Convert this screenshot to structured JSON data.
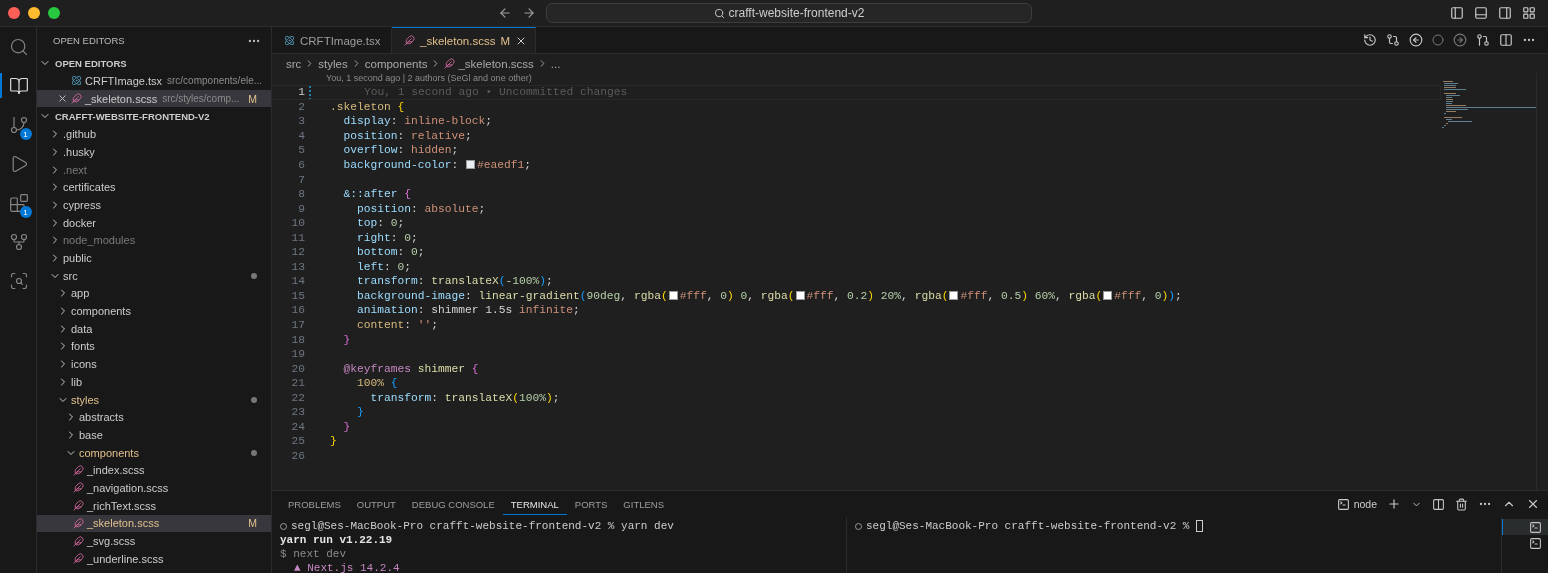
{
  "title_bar": {
    "search": "crafft-website-frontend-v2"
  },
  "activity_bar": [
    {
      "kind": "search",
      "selected": false
    },
    {
      "kind": "explorer",
      "selected": true
    },
    {
      "kind": "source-control",
      "selected": false,
      "badge": "1"
    },
    {
      "kind": "run",
      "selected": false
    },
    {
      "kind": "extensions",
      "selected": false,
      "badge": "1"
    },
    {
      "kind": "gitlens",
      "selected": false
    },
    {
      "kind": "inspect",
      "selected": false
    }
  ],
  "sidebar": {
    "title": "OPEN EDITORS",
    "open_editors": {
      "title": "OPEN EDITORS",
      "expanded": true,
      "items": [
        {
          "kind": "tsx",
          "name": "CRFTImage.tsx",
          "path": "src/components/ele...",
          "selected": false
        },
        {
          "kind": "scss",
          "name": "_skeleton.scss",
          "path": "src/styles/comp...",
          "badge": "M",
          "selected": true
        }
      ]
    },
    "explorer": {
      "title": "CRAFFT-WEBSITE-FRONTEND-V2",
      "expanded": true,
      "items": [
        {
          "name": ".github",
          "kind": "folder",
          "expanded": false,
          "dimmed": false,
          "modified": false,
          "dot": false,
          "selected": false
        },
        {
          "name": ".husky",
          "kind": "folder",
          "expanded": false,
          "dimmed": false,
          "modified": false,
          "dot": false,
          "selected": false
        },
        {
          "name": ".next",
          "kind": "folder",
          "expanded": false,
          "dimmed": true,
          "modified": false,
          "dot": false,
          "selected": false
        },
        {
          "name": "certificates",
          "kind": "folder",
          "expanded": false,
          "dimmed": false,
          "modified": false,
          "dot": false,
          "selected": false
        },
        {
          "name": "cypress",
          "kind": "folder",
          "expanded": false,
          "dimmed": false,
          "modified": false,
          "dot": false,
          "selected": false
        },
        {
          "name": "docker",
          "kind": "folder",
          "expanded": false,
          "dimmed": false,
          "modified": false,
          "dot": false,
          "selected": false
        },
        {
          "name": "node_modules",
          "kind": "folder",
          "expanded": false,
          "dimmed": true,
          "modified": false,
          "dot": false,
          "selected": false
        },
        {
          "name": "public",
          "kind": "folder",
          "expanded": false,
          "dimmed": false,
          "modified": false,
          "dot": false,
          "selected": false
        },
        {
          "name": "src",
          "kind": "folder",
          "expanded": true,
          "dimmed": false,
          "modified": false,
          "dot": true,
          "selected": false,
          "children": [
            {
              "name": "app",
              "kind": "folder",
              "expanded": false,
              "dimmed": false,
              "modified": false,
              "dot": false,
              "selected": false
            },
            {
              "name": "components",
              "kind": "folder",
              "expanded": false,
              "dimmed": false,
              "modified": false,
              "dot": false,
              "selected": false
            },
            {
              "name": "data",
              "kind": "folder",
              "expanded": false,
              "dimmed": false,
              "modified": false,
              "dot": false,
              "selected": false
            },
            {
              "name": "fonts",
              "kind": "folder",
              "expanded": false,
              "dimmed": false,
              "modified": false,
              "dot": false,
              "selected": false
            },
            {
              "name": "icons",
              "kind": "folder",
              "expanded": false,
              "dimmed": false,
              "modified": false,
              "dot": false,
              "selected": false
            },
            {
              "name": "lib",
              "kind": "folder",
              "expanded": false,
              "dimmed": false,
              "modified": false,
              "dot": false,
              "selected": false
            },
            {
              "name": "styles",
              "kind": "folder",
              "expanded": true,
              "dimmed": false,
              "modified": true,
              "dot": true,
              "selected": false,
              "children": [
                {
                  "name": "abstracts",
                  "kind": "folder",
                  "expanded": false,
                  "dimmed": false,
                  "modified": false,
                  "dot": false,
                  "selected": false
                },
                {
                  "name": "base",
                  "kind": "folder",
                  "expanded": false,
                  "dimmed": false,
                  "modified": false,
                  "dot": false,
                  "selected": false
                },
                {
                  "name": "components",
                  "kind": "folder",
                  "expanded": true,
                  "dimmed": false,
                  "modified": true,
                  "dot": true,
                  "selected": false,
                  "children": [
                    {
                      "name": "_index.scss",
                      "kind": "scss",
                      "dimmed": false,
                      "modified": false,
                      "dot": false,
                      "selected": false
                    },
                    {
                      "name": "_navigation.scss",
                      "kind": "scss",
                      "dimmed": false,
                      "modified": false,
                      "dot": false,
                      "selected": false
                    },
                    {
                      "name": "_richText.scss",
                      "kind": "scss",
                      "dimmed": false,
                      "modified": false,
                      "dot": false,
                      "selected": false
                    },
                    {
                      "name": "_skeleton.scss",
                      "kind": "scss",
                      "dimmed": false,
                      "modified": true,
                      "dot": false,
                      "selected": true,
                      "badge": "M"
                    },
                    {
                      "name": "_svg.scss",
                      "kind": "scss",
                      "dimmed": false,
                      "modified": false,
                      "dot": false,
                      "selected": false
                    },
                    {
                      "name": "_underline.scss",
                      "kind": "scss",
                      "dimmed": false,
                      "modified": false,
                      "dot": false,
                      "selected": false
                    }
                  ]
                }
              ]
            }
          ]
        }
      ]
    }
  },
  "editor": {
    "tabs": [
      {
        "label": "CRFTImage.tsx",
        "kind": "tsx",
        "selected": false
      },
      {
        "label": "_skeleton.scss",
        "kind": "scss",
        "selected": true,
        "badge": "M"
      }
    ],
    "breadcrumbs": [
      {
        "text": "src",
        "kind": "folder"
      },
      {
        "text": "styles",
        "kind": "folder"
      },
      {
        "text": "components",
        "kind": "folder"
      },
      {
        "text": "_skeleton.scss",
        "kind": "scss"
      },
      {
        "text": "...",
        "kind": "more"
      }
    ],
    "codelens": "You, 1 second ago | 2 authors (SeGl and one other)",
    "lines": [
      {
        "number": "1",
        "active": true,
        "tokens": [
          {
            "kind": "blame",
            "text": "You, 1 second ago • Uncommitted changes"
          }
        ]
      },
      {
        "number": "2",
        "active": false,
        "tokens": [
          {
            "kind": "selector",
            "text": ".skeleton "
          },
          {
            "kind": "brace1",
            "text": "{"
          }
        ]
      },
      {
        "number": "3",
        "active": false,
        "tokens": [
          {
            "kind": "prop",
            "text": "  display"
          },
          {
            "kind": "plain",
            "text": ": "
          },
          {
            "kind": "value",
            "text": "inline-block"
          },
          {
            "kind": "plain",
            "text": ";"
          }
        ]
      },
      {
        "number": "4",
        "active": false,
        "tokens": [
          {
            "kind": "prop",
            "text": "  position"
          },
          {
            "kind": "plain",
            "text": ": "
          },
          {
            "kind": "value",
            "text": "relative"
          },
          {
            "kind": "plain",
            "text": ";"
          }
        ]
      },
      {
        "number": "5",
        "active": false,
        "tokens": [
          {
            "kind": "prop",
            "text": "  overflow"
          },
          {
            "kind": "plain",
            "text": ": "
          },
          {
            "kind": "value",
            "text": "hidden"
          },
          {
            "kind": "plain",
            "text": ";"
          }
        ]
      },
      {
        "number": "6",
        "active": false,
        "tokens": [
          {
            "kind": "prop",
            "text": "  background-color"
          },
          {
            "kind": "plain",
            "text": ": "
          },
          {
            "kind": "swatch",
            "color": "#eaedf1"
          },
          {
            "kind": "value",
            "text": "#eaedf1"
          },
          {
            "kind": "plain",
            "text": ";"
          }
        ]
      },
      {
        "number": "7",
        "active": false
      },
      {
        "number": "8",
        "active": false,
        "tokens": [
          {
            "kind": "prop",
            "text": "  &::after "
          },
          {
            "kind": "brace2",
            "text": "{"
          }
        ]
      },
      {
        "number": "9",
        "active": false,
        "tokens": [
          {
            "kind": "prop",
            "text": "    position"
          },
          {
            "kind": "plain",
            "text": ": "
          },
          {
            "kind": "value",
            "text": "absolute"
          },
          {
            "kind": "plain",
            "text": ";"
          }
        ]
      },
      {
        "number": "10",
        "active": false,
        "tokens": [
          {
            "kind": "prop",
            "text": "    top"
          },
          {
            "kind": "plain",
            "text": ": "
          },
          {
            "kind": "number",
            "text": "0"
          },
          {
            "kind": "plain",
            "text": ";"
          }
        ]
      },
      {
        "number": "11",
        "active": false,
        "tokens": [
          {
            "kind": "prop",
            "text": "    right"
          },
          {
            "kind": "plain",
            "text": ": "
          },
          {
            "kind": "number",
            "text": "0"
          },
          {
            "kind": "plain",
            "text": ";"
          }
        ]
      },
      {
        "number": "12",
        "active": false,
        "tokens": [
          {
            "kind": "prop",
            "text": "    bottom"
          },
          {
            "kind": "plain",
            "text": ": "
          },
          {
            "kind": "number",
            "text": "0"
          },
          {
            "kind": "plain",
            "text": ";"
          }
        ]
      },
      {
        "number": "13",
        "active": false,
        "tokens": [
          {
            "kind": "prop",
            "text": "    left"
          },
          {
            "kind": "plain",
            "text": ": "
          },
          {
            "kind": "number",
            "text": "0"
          },
          {
            "kind": "plain",
            "text": ";"
          }
        ]
      },
      {
        "number": "14",
        "active": false,
        "tokens": [
          {
            "kind": "prop",
            "text": "    transform"
          },
          {
            "kind": "plain",
            "text": ": "
          },
          {
            "kind": "func",
            "text": "translateX"
          },
          {
            "kind": "brace3",
            "text": "("
          },
          {
            "kind": "number",
            "text": "-100%"
          },
          {
            "kind": "brace3",
            "text": ")"
          },
          {
            "kind": "plain",
            "text": ";"
          }
        ]
      },
      {
        "number": "15",
        "active": false,
        "tokens": [
          {
            "kind": "prop",
            "text": "    background-image"
          },
          {
            "kind": "plain",
            "text": ": "
          },
          {
            "kind": "func",
            "text": "linear-gradient"
          },
          {
            "kind": "brace3",
            "text": "("
          },
          {
            "kind": "number",
            "text": "90deg"
          },
          {
            "kind": "plain",
            "text": ", "
          },
          {
            "kind": "func",
            "text": "rgba"
          },
          {
            "kind": "brace1",
            "text": "("
          },
          {
            "kind": "swatch",
            "color": "#ffffff"
          },
          {
            "kind": "value",
            "text": "#fff"
          },
          {
            "kind": "plain",
            "text": ", "
          },
          {
            "kind": "number",
            "text": "0"
          },
          {
            "kind": "brace1",
            "text": ")"
          },
          {
            "kind": "number",
            "text": " 0"
          },
          {
            "kind": "plain",
            "text": ", "
          },
          {
            "kind": "func",
            "text": "rgba"
          },
          {
            "kind": "brace1",
            "text": "("
          },
          {
            "kind": "swatch",
            "color": "#ffffff"
          },
          {
            "kind": "value",
            "text": "#fff"
          },
          {
            "kind": "plain",
            "text": ", "
          },
          {
            "kind": "number",
            "text": "0.2"
          },
          {
            "kind": "brace1",
            "text": ")"
          },
          {
            "kind": "number",
            "text": " 20%"
          },
          {
            "kind": "plain",
            "text": ", "
          },
          {
            "kind": "func",
            "text": "rgba"
          },
          {
            "kind": "brace1",
            "text": "("
          },
          {
            "kind": "swatch",
            "color": "#ffffff"
          },
          {
            "kind": "value",
            "text": "#fff"
          },
          {
            "kind": "plain",
            "text": ", "
          },
          {
            "kind": "number",
            "text": "0.5"
          },
          {
            "kind": "brace1",
            "text": ")"
          },
          {
            "kind": "number",
            "text": " 60%"
          },
          {
            "kind": "plain",
            "text": ", "
          },
          {
            "kind": "func",
            "text": "rgba"
          },
          {
            "kind": "brace1",
            "text": "("
          },
          {
            "kind": "swatch",
            "color": "#ffffff"
          },
          {
            "kind": "value",
            "text": "#fff"
          },
          {
            "kind": "plain",
            "text": ", "
          },
          {
            "kind": "number",
            "text": "0"
          },
          {
            "kind": "brace1",
            "text": ")"
          },
          {
            "kind": "brace3",
            "text": ")"
          },
          {
            "kind": "plain",
            "text": ";"
          }
        ]
      },
      {
        "number": "16",
        "active": false,
        "tokens": [
          {
            "kind": "prop",
            "text": "    animation"
          },
          {
            "kind": "plain",
            "text": ": shimmer 1.5s "
          },
          {
            "kind": "value",
            "text": "infinite"
          },
          {
            "kind": "plain",
            "text": ";"
          }
        ]
      },
      {
        "number": "17",
        "active": false,
        "tokens": [
          {
            "kind": "keyprop",
            "text": "    content"
          },
          {
            "kind": "plain",
            "text": ": "
          },
          {
            "kind": "value",
            "text": "''"
          },
          {
            "kind": "plain",
            "text": ";"
          }
        ]
      },
      {
        "number": "18",
        "active": false,
        "tokens": [
          {
            "kind": "brace2",
            "text": "  }"
          }
        ]
      },
      {
        "number": "19",
        "active": false
      },
      {
        "number": "20",
        "active": false,
        "tokens": [
          {
            "kind": "keyword",
            "text": "  @keyframes "
          },
          {
            "kind": "func",
            "text": "shimmer "
          },
          {
            "kind": "brace2",
            "text": "{"
          }
        ]
      },
      {
        "number": "21",
        "active": false,
        "tokens": [
          {
            "kind": "selector",
            "text": "    100% "
          },
          {
            "kind": "brace3",
            "text": "{"
          }
        ]
      },
      {
        "number": "22",
        "active": false,
        "tokens": [
          {
            "kind": "prop",
            "text": "      transform"
          },
          {
            "kind": "plain",
            "text": ": "
          },
          {
            "kind": "func",
            "text": "translateX"
          },
          {
            "kind": "brace1",
            "text": "("
          },
          {
            "kind": "number",
            "text": "100%"
          },
          {
            "kind": "brace1",
            "text": ")"
          },
          {
            "kind": "plain",
            "text": ";"
          }
        ]
      },
      {
        "number": "23",
        "active": false,
        "tokens": [
          {
            "kind": "brace3",
            "text": "    }"
          }
        ]
      },
      {
        "number": "24",
        "active": false,
        "tokens": [
          {
            "kind": "brace2",
            "text": "  }"
          }
        ]
      },
      {
        "number": "25",
        "active": false,
        "tokens": [
          {
            "kind": "brace1",
            "text": "}"
          }
        ]
      },
      {
        "number": "26",
        "active": false
      }
    ]
  },
  "panel": {
    "tabs": [
      {
        "label": "PROBLEMS",
        "selected": false
      },
      {
        "label": "OUTPUT",
        "selected": false
      },
      {
        "label": "DEBUG CONSOLE",
        "selected": false
      },
      {
        "label": "TERMINAL",
        "selected": true
      },
      {
        "label": "PORTS",
        "selected": false
      },
      {
        "label": "GITLENS",
        "selected": false
      }
    ],
    "terminal_profile": "node",
    "panes": [
      {
        "lines": [
          {
            "kind": "prompt",
            "text": "segl@Ses-MacBook-Pro crafft-website-frontend-v2 % yarn dev",
            "cursor": false
          },
          {
            "kind": "bold",
            "text": "yarn run v1.22.19"
          },
          {
            "kind": "muted",
            "text": "$ next dev"
          },
          {
            "kind": "accent",
            "text": "▲ Next.js 14.2.4"
          }
        ]
      },
      {
        "lines": [
          {
            "kind": "prompt",
            "text": "segl@Ses-MacBook-Pro crafft-website-frontend-v2 %",
            "cursor": true
          }
        ]
      }
    ],
    "terminal_list": [
      {
        "selected": true
      },
      {
        "selected": false
      }
    ]
  }
}
